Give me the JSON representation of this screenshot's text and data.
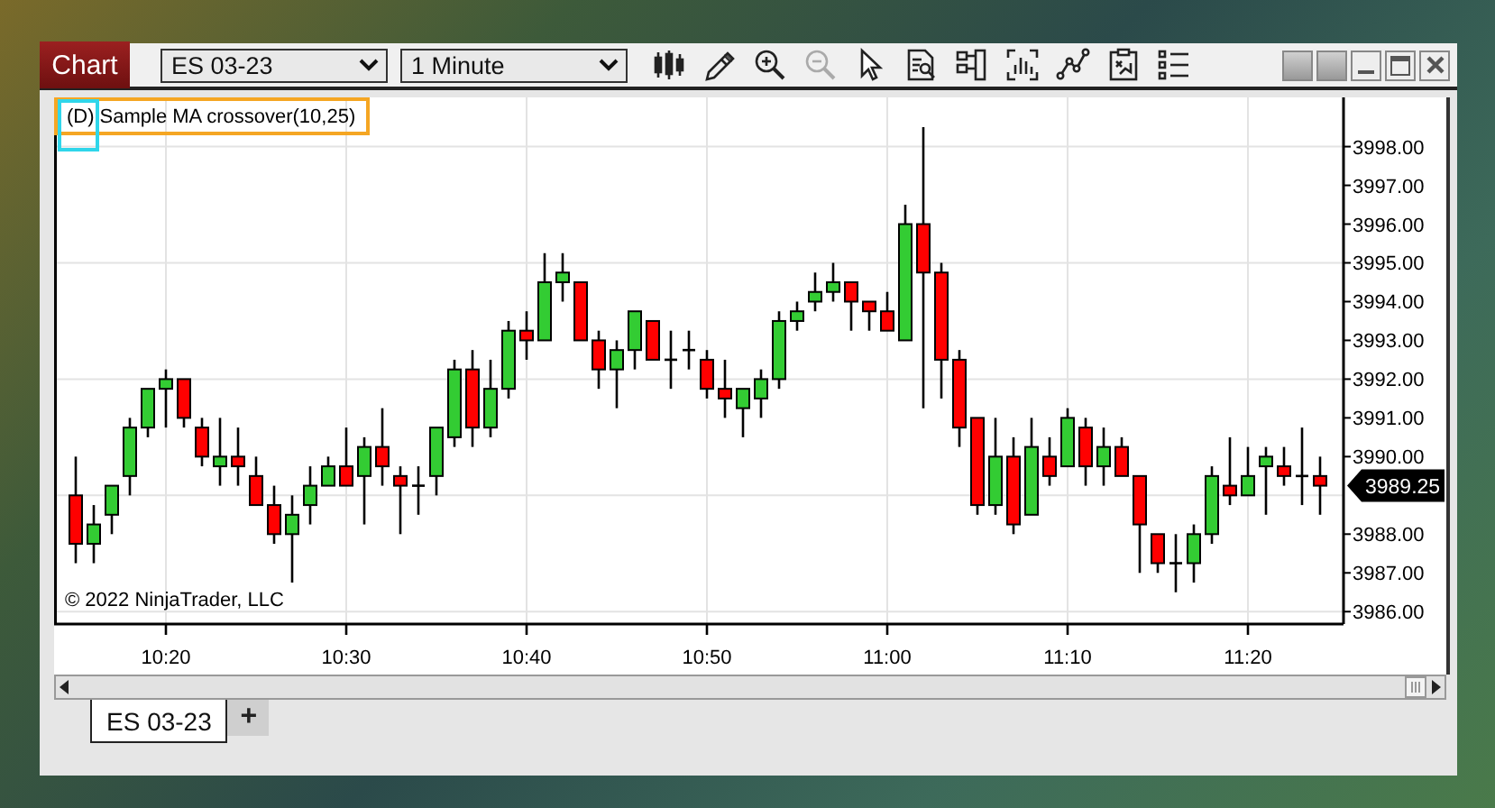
{
  "window": {
    "title_button": "Chart",
    "instrument_select": {
      "value": "ES 03-23"
    },
    "interval_select": {
      "value": "1 Minute"
    },
    "toolbar": [
      {
        "kind": "candles",
        "disabled": false
      },
      {
        "kind": "pencil",
        "disabled": false
      },
      {
        "kind": "zoom_in",
        "disabled": false
      },
      {
        "kind": "zoom_out",
        "disabled": true
      },
      {
        "kind": "pointer",
        "disabled": false
      },
      {
        "kind": "data_box",
        "disabled": false
      },
      {
        "kind": "properties",
        "disabled": false
      },
      {
        "kind": "bars",
        "disabled": false
      },
      {
        "kind": "line",
        "disabled": false
      },
      {
        "kind": "template",
        "disabled": false
      },
      {
        "kind": "list",
        "disabled": false
      }
    ]
  },
  "chart": {
    "legend": {
      "flag": "(D)",
      "label": "Sample MA crossover(10,25)"
    },
    "copyright": "© 2022 NinjaTrader, LLC",
    "last_price": "3989.25",
    "chart_data": {
      "type": "candlestick",
      "grid": true,
      "ylim": [
        3985.68,
        3999.27
      ],
      "categories": [
        null,
        null,
        null,
        null,
        null,
        "10:20",
        null,
        null,
        null,
        null,
        null,
        null,
        null,
        null,
        null,
        "10:30",
        null,
        null,
        null,
        null,
        null,
        null,
        null,
        null,
        null,
        "10:40",
        null,
        null,
        null,
        null,
        null,
        null,
        null,
        null,
        null,
        "10:50",
        null,
        null,
        null,
        null,
        null,
        null,
        null,
        null,
        null,
        "11:00",
        null,
        null,
        null,
        null,
        null,
        null,
        null,
        null,
        null,
        "11:10",
        null,
        null,
        null,
        null,
        null,
        null,
        null,
        null,
        null,
        "11:20",
        null,
        null,
        null,
        null
      ],
      "yticks": [
        {
          "value": 3998,
          "label": "3998.00"
        },
        {
          "value": 3997,
          "label": "3997.00"
        },
        {
          "value": 3996,
          "label": "3996.00"
        },
        {
          "value": 3995,
          "label": "3995.00"
        },
        {
          "value": 3994,
          "label": "3994.00"
        },
        {
          "value": 3993,
          "label": "3993.00"
        },
        {
          "value": 3992,
          "label": "3992.00"
        },
        {
          "value": 3991,
          "label": "3991.00"
        },
        {
          "value": 3990,
          "label": "3990.00"
        },
        {
          "value": 3988,
          "label": "3988.00"
        },
        {
          "value": 3987,
          "label": "3987.00"
        },
        {
          "value": 3986,
          "label": "3986.00"
        }
      ],
      "ohlc": [
        [
          3989.0,
          3990.0,
          3987.25,
          3987.75
        ],
        [
          3987.75,
          3988.75,
          3987.25,
          3988.25
        ],
        [
          3988.5,
          3989.25,
          3988.0,
          3989.25
        ],
        [
          3989.5,
          3991.0,
          3989.0,
          3990.75
        ],
        [
          3990.75,
          3991.75,
          3990.5,
          3991.75
        ],
        [
          3991.75,
          3992.25,
          3990.75,
          3992.0
        ],
        [
          3992.0,
          3992.0,
          3990.75,
          3991.0
        ],
        [
          3990.75,
          3991.0,
          3989.75,
          3990.0
        ],
        [
          3989.75,
          3991.0,
          3989.25,
          3990.0
        ],
        [
          3990.0,
          3990.75,
          3989.25,
          3989.75
        ],
        [
          3989.5,
          3990.0,
          3988.75,
          3988.75
        ],
        [
          3988.75,
          3989.25,
          3987.75,
          3988.0
        ],
        [
          3988.0,
          3989.0,
          3986.75,
          3988.5
        ],
        [
          3988.75,
          3989.75,
          3988.25,
          3989.25
        ],
        [
          3989.25,
          3990.0,
          3989.25,
          3989.75
        ],
        [
          3989.75,
          3990.75,
          3989.25,
          3989.25
        ],
        [
          3989.5,
          3990.5,
          3988.25,
          3990.25
        ],
        [
          3990.25,
          3991.25,
          3989.25,
          3989.75
        ],
        [
          3989.5,
          3989.75,
          3988.0,
          3989.25
        ],
        [
          3989.25,
          3989.75,
          3988.5,
          3989.25
        ],
        [
          3989.5,
          3990.75,
          3989.0,
          3990.75
        ],
        [
          3990.5,
          3992.5,
          3990.25,
          3992.25
        ],
        [
          3992.25,
          3992.75,
          3990.25,
          3990.75
        ],
        [
          3990.75,
          3992.5,
          3990.5,
          3991.75
        ],
        [
          3991.75,
          3993.5,
          3991.5,
          3993.25
        ],
        [
          3993.25,
          3993.75,
          3992.5,
          3993.0
        ],
        [
          3993.0,
          3995.25,
          3993.0,
          3994.5
        ],
        [
          3994.5,
          3995.25,
          3994.0,
          3994.75
        ],
        [
          3994.5,
          3994.5,
          3993.0,
          3993.0
        ],
        [
          3993.0,
          3993.25,
          3991.75,
          3992.25
        ],
        [
          3992.25,
          3993.0,
          3991.25,
          3992.75
        ],
        [
          3992.75,
          3993.75,
          3992.25,
          3993.75
        ],
        [
          3993.5,
          3993.5,
          3992.5,
          3992.5
        ],
        [
          3992.5,
          3993.25,
          3991.75,
          3992.5
        ],
        [
          3992.75,
          3993.25,
          3992.25,
          3992.75
        ],
        [
          3992.5,
          3992.75,
          3991.5,
          3991.75
        ],
        [
          3991.75,
          3992.5,
          3991.0,
          3991.5
        ],
        [
          3991.25,
          3991.75,
          3990.5,
          3991.75
        ],
        [
          3991.5,
          3992.25,
          3991.0,
          3992.0
        ],
        [
          3992.0,
          3993.75,
          3991.75,
          3993.5
        ],
        [
          3993.5,
          3994.0,
          3993.25,
          3993.75
        ],
        [
          3994.0,
          3994.75,
          3993.75,
          3994.25
        ],
        [
          3994.25,
          3995.0,
          3994.0,
          3994.5
        ],
        [
          3994.5,
          3994.5,
          3993.25,
          3994.0
        ],
        [
          3994.0,
          3994.0,
          3993.25,
          3993.75
        ],
        [
          3993.75,
          3994.25,
          3993.25,
          3993.25
        ],
        [
          3993.0,
          3996.5,
          3993.0,
          3996.0
        ],
        [
          3996.0,
          3998.5,
          3991.25,
          3994.75
        ],
        [
          3994.75,
          3995.0,
          3991.5,
          3992.5
        ],
        [
          3992.5,
          3992.75,
          3990.25,
          3990.75
        ],
        [
          3991.0,
          3991.0,
          3988.5,
          3988.75
        ],
        [
          3988.75,
          3991.0,
          3988.5,
          3990.0
        ],
        [
          3990.0,
          3990.5,
          3988.0,
          3988.25
        ],
        [
          3988.5,
          3991.0,
          3988.5,
          3990.25
        ],
        [
          3990.0,
          3990.5,
          3989.25,
          3989.5
        ],
        [
          3989.75,
          3991.25,
          3989.75,
          3991.0
        ],
        [
          3990.75,
          3991.0,
          3989.25,
          3989.75
        ],
        [
          3989.75,
          3990.75,
          3989.25,
          3990.25
        ],
        [
          3990.25,
          3990.5,
          3989.5,
          3989.5
        ],
        [
          3989.5,
          3989.5,
          3987.0,
          3988.25
        ],
        [
          3988.0,
          3988.0,
          3987.0,
          3987.25
        ],
        [
          3987.25,
          3988.0,
          3986.5,
          3987.25
        ],
        [
          3987.25,
          3988.25,
          3986.75,
          3988.0
        ],
        [
          3988.0,
          3989.75,
          3987.75,
          3989.5
        ],
        [
          3989.25,
          3990.5,
          3988.75,
          3989.0
        ],
        [
          3989.0,
          3990.25,
          3989.0,
          3989.5
        ],
        [
          3989.75,
          3990.25,
          3988.5,
          3990.0
        ],
        [
          3989.75,
          3990.25,
          3989.25,
          3989.5
        ],
        [
          3989.5,
          3990.75,
          3988.75,
          3989.5
        ],
        [
          3989.5,
          3990.0,
          3988.5,
          3989.25
        ]
      ]
    }
  },
  "tabs": [
    {
      "label": "ES 03-23",
      "selected": true
    }
  ],
  "add_tab": "+"
}
